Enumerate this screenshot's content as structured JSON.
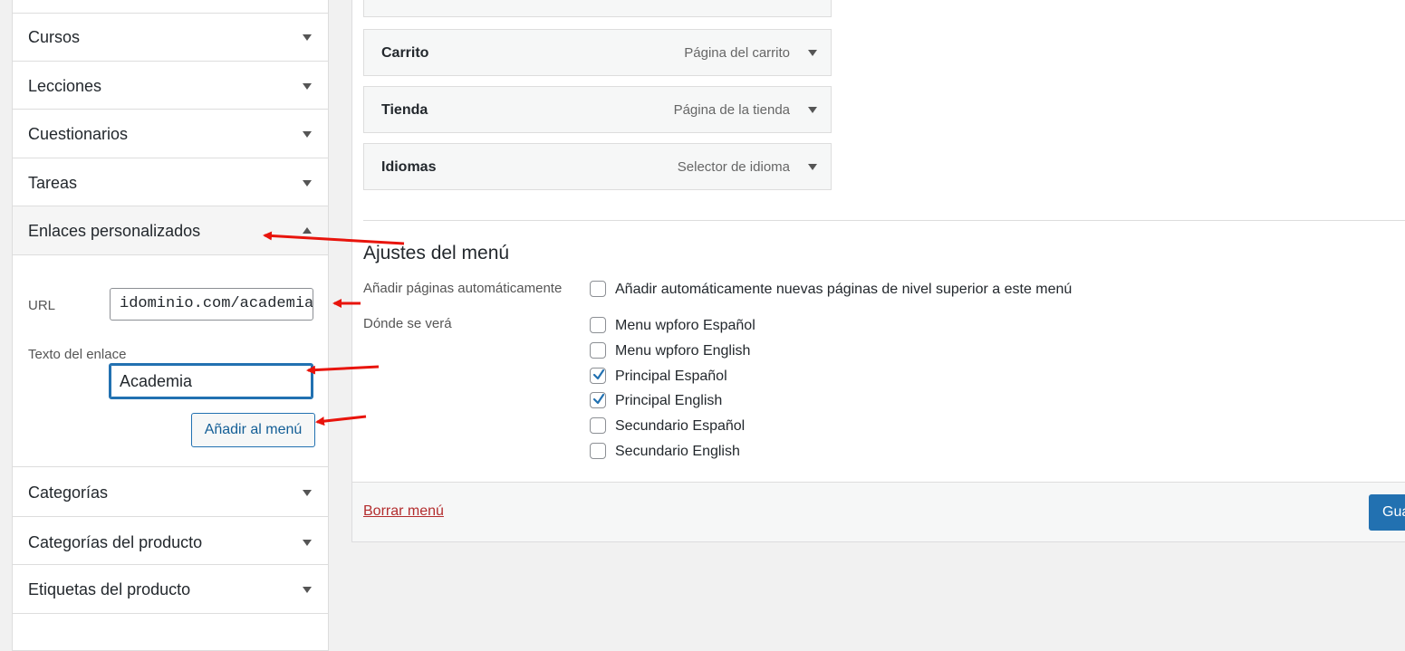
{
  "sidebar": {
    "items": [
      {
        "label": "Cursos"
      },
      {
        "label": "Lecciones"
      },
      {
        "label": "Cuestionarios"
      },
      {
        "label": "Tareas"
      },
      {
        "label": "Enlaces personalizados"
      },
      {
        "label": "Categorías"
      },
      {
        "label": "Categorías del producto"
      },
      {
        "label": "Etiquetas del producto"
      }
    ],
    "custom_links": {
      "url_label": "URL",
      "url_value": "idominio.com/academia",
      "text_label": "Texto del enlace",
      "text_value": "Academia",
      "add_button": "Añadir al menú"
    }
  },
  "main": {
    "locations": [
      {
        "name": "Carrito",
        "desc": "Página del carrito"
      },
      {
        "name": "Tienda",
        "desc": "Página de la tienda"
      },
      {
        "name": "Idiomas",
        "desc": "Selector de idioma"
      }
    ],
    "settings": {
      "title": "Ajustes del menú",
      "auto_add_label": "Añadir páginas automáticamente",
      "auto_add_option": "Añadir automáticamente nuevas páginas de nivel superior a este menú",
      "display_label": "Dónde se verá",
      "display_options": [
        {
          "label": "Menu wpforo Español",
          "checked": false
        },
        {
          "label": "Menu wpforo English",
          "checked": false
        },
        {
          "label": "Principal Español",
          "checked": true
        },
        {
          "label": "Principal English",
          "checked": true
        },
        {
          "label": "Secundario Español",
          "checked": false
        },
        {
          "label": "Secundario English",
          "checked": false
        }
      ]
    },
    "footer": {
      "delete_link": "Borrar menú",
      "save_button": "Gua"
    }
  },
  "colors": {
    "accent": "#2271b1",
    "delete": "#b32d2e",
    "annotation_arrows": "#e8140c"
  }
}
